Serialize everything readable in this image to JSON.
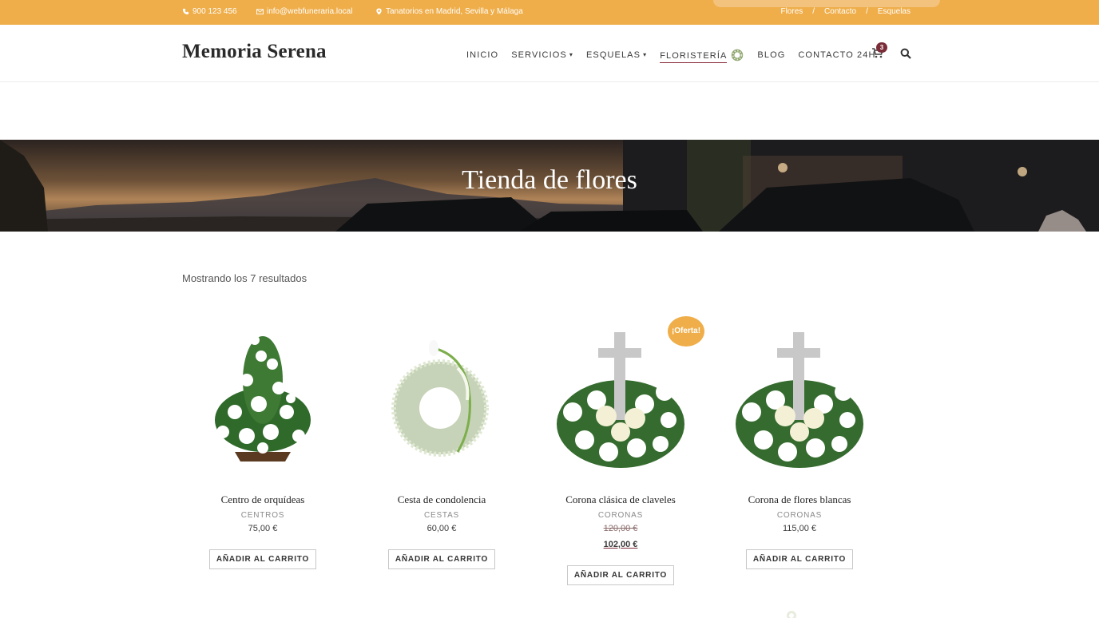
{
  "topbar": {
    "phone": "900 123 456",
    "email": "info@webfuneraria.local",
    "location": "Tanatorios en Madrid, Sevilla y Málaga",
    "links": [
      "Flores",
      "Contacto",
      "Esquelas"
    ]
  },
  "header": {
    "logo": "Memoria Serena",
    "nav": [
      {
        "label": "INICIO"
      },
      {
        "label": "SERVICIOS"
      },
      {
        "label": "ESQUELAS"
      },
      {
        "label": "FLORISTERÍA"
      },
      {
        "label": "BLOG"
      },
      {
        "label": "CONTACTO 24H"
      }
    ],
    "cart_count": "3"
  },
  "hero": {
    "title": "Tienda de flores"
  },
  "results": {
    "count_text": "Mostrando los 7 resultados"
  },
  "products": [
    {
      "name": "Centro de orquídeas",
      "category": "CENTROS",
      "price": "75,00 €",
      "button": "AÑADIR AL CARRITO"
    },
    {
      "name": "Cesta de condolencia",
      "category": "CESTAS",
      "price": "60,00 €",
      "button": "AÑADIR AL CARRITO"
    },
    {
      "name": "Corona clásica de claveles",
      "category": "CORONAS",
      "old_price": "120,00 €",
      "price": "102,00 €",
      "badge": "¡Oferta!",
      "button": "AÑADIR AL CARRITO"
    },
    {
      "name": "Corona de flores blancas",
      "category": "CORONAS",
      "price": "115,00 €",
      "button": "AÑADIR AL CARRITO"
    }
  ],
  "colors": {
    "accent": "#efae4a",
    "brand": "#7a2c38"
  }
}
